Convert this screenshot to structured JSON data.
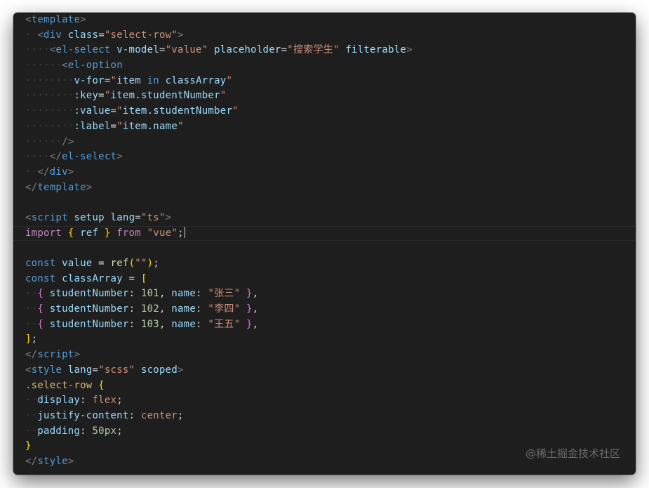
{
  "editor": {
    "language_scheme": "dark-plus",
    "colors": {
      "background": "#1e1e1e",
      "tag": "#569cd6",
      "attribute": "#9cdcfe",
      "string": "#ce9178",
      "keyword": "#c586c0",
      "function": "#dcdcaa",
      "number": "#b5cea8",
      "bracket": "#ffd700",
      "selector": "#d7ba7d"
    },
    "lines": [
      {
        "id": "line-1",
        "tokens": [
          [
            "ptag",
            "<"
          ],
          [
            "tag",
            "template"
          ],
          [
            "ptag",
            ">"
          ]
        ]
      },
      {
        "id": "line-2",
        "tokens": [
          [
            "ws",
            "··"
          ],
          [
            "ptag",
            "<"
          ],
          [
            "tag",
            "div"
          ],
          [
            "pl",
            " "
          ],
          [
            "attr",
            "class"
          ],
          [
            "pl",
            "="
          ],
          [
            "str",
            "\"select-row\""
          ],
          [
            "ptag",
            ">"
          ]
        ]
      },
      {
        "id": "line-3",
        "tokens": [
          [
            "ws",
            "····"
          ],
          [
            "ptag",
            "<"
          ],
          [
            "tag",
            "el-select"
          ],
          [
            "pl",
            " "
          ],
          [
            "attr",
            "v-model"
          ],
          [
            "pl",
            "="
          ],
          [
            "str",
            "\"value\""
          ],
          [
            "pl",
            " "
          ],
          [
            "attr",
            "placeholder"
          ],
          [
            "pl",
            "="
          ],
          [
            "str",
            "\"搜索学生\""
          ],
          [
            "pl",
            " "
          ],
          [
            "attr",
            "filterable"
          ],
          [
            "ptag",
            ">"
          ]
        ]
      },
      {
        "id": "line-4",
        "tokens": [
          [
            "ws",
            "······"
          ],
          [
            "ptag",
            "<"
          ],
          [
            "tag",
            "el-option"
          ]
        ]
      },
      {
        "id": "line-5",
        "tokens": [
          [
            "ws",
            "········"
          ],
          [
            "attr",
            "v-for"
          ],
          [
            "pl",
            "="
          ],
          [
            "str",
            "\""
          ],
          [
            "var",
            "item"
          ],
          [
            "pl",
            " "
          ],
          [
            "kw2",
            "in"
          ],
          [
            "pl",
            " "
          ],
          [
            "var",
            "classArray"
          ],
          [
            "str",
            "\""
          ]
        ]
      },
      {
        "id": "line-6",
        "tokens": [
          [
            "ws",
            "········"
          ],
          [
            "attr",
            ":key"
          ],
          [
            "pl",
            "="
          ],
          [
            "str",
            "\""
          ],
          [
            "var",
            "item"
          ],
          [
            "pl",
            "."
          ],
          [
            "var",
            "studentNumber"
          ],
          [
            "str",
            "\""
          ]
        ]
      },
      {
        "id": "line-7",
        "tokens": [
          [
            "ws",
            "········"
          ],
          [
            "attr",
            ":value"
          ],
          [
            "pl",
            "="
          ],
          [
            "str",
            "\""
          ],
          [
            "var",
            "item"
          ],
          [
            "pl",
            "."
          ],
          [
            "var",
            "studentNumber"
          ],
          [
            "str",
            "\""
          ]
        ]
      },
      {
        "id": "line-8",
        "tokens": [
          [
            "ws",
            "········"
          ],
          [
            "attr",
            ":label"
          ],
          [
            "pl",
            "="
          ],
          [
            "str",
            "\""
          ],
          [
            "var",
            "item"
          ],
          [
            "pl",
            "."
          ],
          [
            "var",
            "name"
          ],
          [
            "str",
            "\""
          ]
        ]
      },
      {
        "id": "line-9",
        "tokens": [
          [
            "ws",
            "······"
          ],
          [
            "ptag",
            "/>"
          ]
        ]
      },
      {
        "id": "line-10",
        "tokens": [
          [
            "ws",
            "····"
          ],
          [
            "ptag",
            "</"
          ],
          [
            "tag",
            "el-select"
          ],
          [
            "ptag",
            ">"
          ]
        ]
      },
      {
        "id": "line-11",
        "tokens": [
          [
            "ws",
            "··"
          ],
          [
            "ptag",
            "</"
          ],
          [
            "tag",
            "div"
          ],
          [
            "ptag",
            ">"
          ]
        ]
      },
      {
        "id": "line-12",
        "tokens": [
          [
            "ptag",
            "</"
          ],
          [
            "tag",
            "template"
          ],
          [
            "ptag",
            ">"
          ]
        ]
      },
      {
        "id": "line-13",
        "tokens": []
      },
      {
        "id": "line-14",
        "tokens": [
          [
            "ptag",
            "<"
          ],
          [
            "tag",
            "script"
          ],
          [
            "pl",
            " "
          ],
          [
            "attr",
            "setup"
          ],
          [
            "pl",
            " "
          ],
          [
            "attr",
            "lang"
          ],
          [
            "pl",
            "="
          ],
          [
            "str",
            "\"ts\""
          ],
          [
            "ptag",
            ">"
          ]
        ]
      },
      {
        "id": "line-15",
        "current": true,
        "tokens": [
          [
            "kw",
            "import"
          ],
          [
            "pl",
            " "
          ],
          [
            "b1",
            "{"
          ],
          [
            "pl",
            " "
          ],
          [
            "var",
            "ref"
          ],
          [
            "pl",
            " "
          ],
          [
            "b1",
            "}"
          ],
          [
            "pl",
            " "
          ],
          [
            "kw",
            "from"
          ],
          [
            "pl",
            " "
          ],
          [
            "str",
            "\"vue\""
          ],
          [
            "pl",
            ";"
          ]
        ]
      },
      {
        "id": "line-16",
        "tokens": []
      },
      {
        "id": "line-17",
        "tokens": [
          [
            "kw2",
            "const"
          ],
          [
            "pl",
            " "
          ],
          [
            "var",
            "value"
          ],
          [
            "pl",
            " = "
          ],
          [
            "fn",
            "ref"
          ],
          [
            "b1",
            "("
          ],
          [
            "str",
            "\"\""
          ],
          [
            "b1",
            ")"
          ],
          [
            "pl",
            ";"
          ]
        ]
      },
      {
        "id": "line-18",
        "tokens": [
          [
            "kw2",
            "const"
          ],
          [
            "pl",
            " "
          ],
          [
            "var",
            "classArray"
          ],
          [
            "pl",
            " = "
          ],
          [
            "b1",
            "["
          ]
        ]
      },
      {
        "id": "line-19",
        "tokens": [
          [
            "ws",
            "··"
          ],
          [
            "b2",
            "{"
          ],
          [
            "pl",
            " "
          ],
          [
            "prop",
            "studentNumber"
          ],
          [
            "pl",
            ": "
          ],
          [
            "num",
            "101"
          ],
          [
            "pl",
            ", "
          ],
          [
            "prop",
            "name"
          ],
          [
            "pl",
            ": "
          ],
          [
            "str",
            "\"张三\""
          ],
          [
            "pl",
            " "
          ],
          [
            "b2",
            "}"
          ],
          [
            "pl",
            ","
          ]
        ]
      },
      {
        "id": "line-20",
        "tokens": [
          [
            "ws",
            "··"
          ],
          [
            "b2",
            "{"
          ],
          [
            "pl",
            " "
          ],
          [
            "prop",
            "studentNumber"
          ],
          [
            "pl",
            ": "
          ],
          [
            "num",
            "102"
          ],
          [
            "pl",
            ", "
          ],
          [
            "prop",
            "name"
          ],
          [
            "pl",
            ": "
          ],
          [
            "str",
            "\"李四\""
          ],
          [
            "pl",
            " "
          ],
          [
            "b2",
            "}"
          ],
          [
            "pl",
            ","
          ]
        ]
      },
      {
        "id": "line-21",
        "tokens": [
          [
            "ws",
            "··"
          ],
          [
            "b2",
            "{"
          ],
          [
            "pl",
            " "
          ],
          [
            "prop",
            "studentNumber"
          ],
          [
            "pl",
            ": "
          ],
          [
            "num",
            "103"
          ],
          [
            "pl",
            ", "
          ],
          [
            "prop",
            "name"
          ],
          [
            "pl",
            ": "
          ],
          [
            "str",
            "\"王五\""
          ],
          [
            "pl",
            " "
          ],
          [
            "b2",
            "}"
          ],
          [
            "pl",
            ","
          ]
        ]
      },
      {
        "id": "line-22",
        "tokens": [
          [
            "b1",
            "]"
          ],
          [
            "pl",
            ";"
          ]
        ]
      },
      {
        "id": "line-23",
        "tokens": [
          [
            "ptag",
            "</"
          ],
          [
            "tag",
            "script"
          ],
          [
            "ptag",
            ">"
          ]
        ]
      },
      {
        "id": "line-24",
        "tokens": [
          [
            "ptag",
            "<"
          ],
          [
            "tag",
            "style"
          ],
          [
            "pl",
            " "
          ],
          [
            "attr",
            "lang"
          ],
          [
            "pl",
            "="
          ],
          [
            "str",
            "\"scss\""
          ],
          [
            "pl",
            " "
          ],
          [
            "attr",
            "scoped"
          ],
          [
            "ptag",
            ">"
          ]
        ]
      },
      {
        "id": "line-25",
        "tokens": [
          [
            "sel",
            ".select-row"
          ],
          [
            "pl",
            " "
          ],
          [
            "b1",
            "{"
          ]
        ]
      },
      {
        "id": "line-26",
        "tokens": [
          [
            "ws",
            "··"
          ],
          [
            "prop",
            "display"
          ],
          [
            "pl",
            ": "
          ],
          [
            "val",
            "flex"
          ],
          [
            "pl",
            ";"
          ]
        ]
      },
      {
        "id": "line-27",
        "tokens": [
          [
            "ws",
            "··"
          ],
          [
            "prop",
            "justify-content"
          ],
          [
            "pl",
            ": "
          ],
          [
            "val",
            "center"
          ],
          [
            "pl",
            ";"
          ]
        ]
      },
      {
        "id": "line-28",
        "tokens": [
          [
            "ws",
            "··"
          ],
          [
            "prop",
            "padding"
          ],
          [
            "pl",
            ": "
          ],
          [
            "num",
            "50px"
          ],
          [
            "pl",
            ";"
          ]
        ]
      },
      {
        "id": "line-29",
        "tokens": [
          [
            "b1",
            "}"
          ]
        ]
      },
      {
        "id": "line-30",
        "tokens": [
          [
            "ptag",
            "</"
          ],
          [
            "tag",
            "style"
          ],
          [
            "ptag",
            ">"
          ]
        ]
      }
    ]
  },
  "watermark": {
    "text": "@稀土掘金技术社区"
  }
}
